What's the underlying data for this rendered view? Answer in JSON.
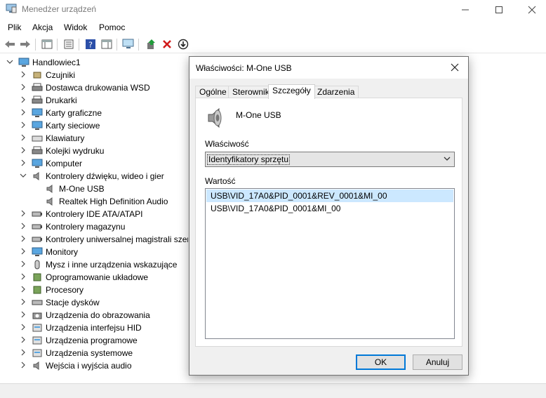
{
  "window": {
    "title": "Menedżer urządzeń",
    "controls": {
      "minimize": "—",
      "maximize": "☐",
      "close": "✕"
    }
  },
  "menu": [
    "Plik",
    "Akcja",
    "Widok",
    "Pomoc"
  ],
  "toolbar": [
    "back-arrow-icon",
    "forward-arrow-icon",
    "console-tree-icon",
    "properties-icon",
    "help-icon",
    "action-pane-icon",
    "monitor-scan-icon",
    "update-driver-icon",
    "uninstall-icon",
    "download-icon"
  ],
  "tree": {
    "root": "Handlowiec1",
    "categories": [
      {
        "label": "Czujniki",
        "icon": "sensor-icon",
        "expanded": false
      },
      {
        "label": "Dostawca drukowania WSD",
        "icon": "printer-icon",
        "expanded": false
      },
      {
        "label": "Drukarki",
        "icon": "printer-icon",
        "expanded": false
      },
      {
        "label": "Karty graficzne",
        "icon": "display-adapter-icon",
        "expanded": false
      },
      {
        "label": "Karty sieciowe",
        "icon": "network-adapter-icon",
        "expanded": false
      },
      {
        "label": "Klawiatury",
        "icon": "keyboard-icon",
        "expanded": false
      },
      {
        "label": "Kolejki wydruku",
        "icon": "print-queue-icon",
        "expanded": false
      },
      {
        "label": "Komputer",
        "icon": "computer-icon",
        "expanded": false
      },
      {
        "label": "Kontrolery dźwięku, wideo i gier",
        "icon": "speaker-icon",
        "expanded": true,
        "children": [
          "M-One  USB",
          "Realtek High Definition Audio"
        ]
      },
      {
        "label": "Kontrolery IDE ATA/ATAPI",
        "icon": "ide-controller-icon",
        "expanded": false
      },
      {
        "label": "Kontrolery magazynu",
        "icon": "storage-controller-icon",
        "expanded": false
      },
      {
        "label": "Kontrolery uniwersalnej magistrali szeregowej",
        "icon": "usb-icon",
        "expanded": false
      },
      {
        "label": "Monitory",
        "icon": "monitor-icon",
        "expanded": false
      },
      {
        "label": "Mysz i inne urządzenia wskazujące",
        "icon": "mouse-icon",
        "expanded": false
      },
      {
        "label": "Oprogramowanie układowe",
        "icon": "firmware-icon",
        "expanded": false
      },
      {
        "label": "Procesory",
        "icon": "processor-icon",
        "expanded": false
      },
      {
        "label": "Stacje dysków",
        "icon": "disk-drive-icon",
        "expanded": false
      },
      {
        "label": "Urządzenia do obrazowania",
        "icon": "camera-icon",
        "expanded": false
      },
      {
        "label": "Urządzenia interfejsu HID",
        "icon": "hid-icon",
        "expanded": false
      },
      {
        "label": "Urządzenia programowe",
        "icon": "software-device-icon",
        "expanded": false
      },
      {
        "label": "Urządzenia systemowe",
        "icon": "system-device-icon",
        "expanded": false
      },
      {
        "label": "Wejścia i wyjścia audio",
        "icon": "speaker-icon",
        "expanded": false
      }
    ]
  },
  "dialog": {
    "title": "Właściwości: M-One  USB",
    "close": "✕",
    "tabs": [
      "Ogólne",
      "Sterownik",
      "Szczegóły",
      "Zdarzenia"
    ],
    "active_tab": "Szczegóły",
    "device_name": "M-One  USB",
    "property_label": "Właściwość",
    "property_value": "Identyfikatory sprzętu",
    "value_label": "Wartość",
    "values": [
      "USB\\VID_17A0&PID_0001&REV_0001&MI_00",
      "USB\\VID_17A0&PID_0001&MI_00"
    ],
    "selected_value_index": 0,
    "ok": "OK",
    "cancel": "Anuluj"
  },
  "colors": {
    "selection": "#cce8ff",
    "default_button_border": "#0078d7",
    "dialog_background": "#f0f0f0"
  }
}
